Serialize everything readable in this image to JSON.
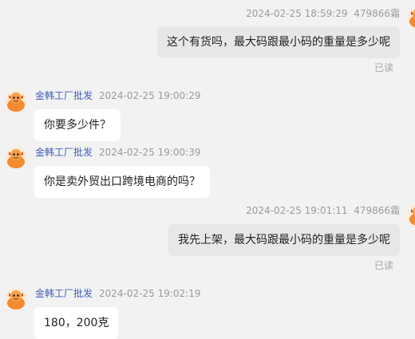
{
  "messages": [
    {
      "direction": "outgoing",
      "timestamp": "2024-02-25 18:59:29",
      "sender": "479866霜",
      "text": "这个有货吗，最大码跟最小码的重量是多少呢",
      "status": "已读"
    },
    {
      "direction": "incoming",
      "sender": "金韩工厂批发",
      "timestamp": "2024-02-25 19:00:29",
      "text": "你要多少件？"
    },
    {
      "direction": "incoming",
      "sender": "金韩工厂批发",
      "timestamp": "2024-02-25 19:00:39",
      "text": "你是卖外贸出口跨境电商的吗？"
    },
    {
      "direction": "outgoing",
      "timestamp": "2024-02-25 19:01:11",
      "sender": "479866霜",
      "text": "我先上架，最大码跟最小码的重量是多少呢",
      "status": "已读"
    },
    {
      "direction": "incoming",
      "sender": "金韩工厂批发",
      "timestamp": "2024-02-25 19:02:19",
      "text": "180，200克"
    }
  ],
  "colors": {
    "background": "#f2f2f2",
    "incoming_bubble": "#ffffff",
    "outgoing_bubble": "#e7e7e7",
    "sender_name": "#3f5fb8",
    "meta_text": "#9b9b9b",
    "avatar": "#f28a2e"
  },
  "icons": {
    "avatar": "cartoon-face-avatar"
  }
}
